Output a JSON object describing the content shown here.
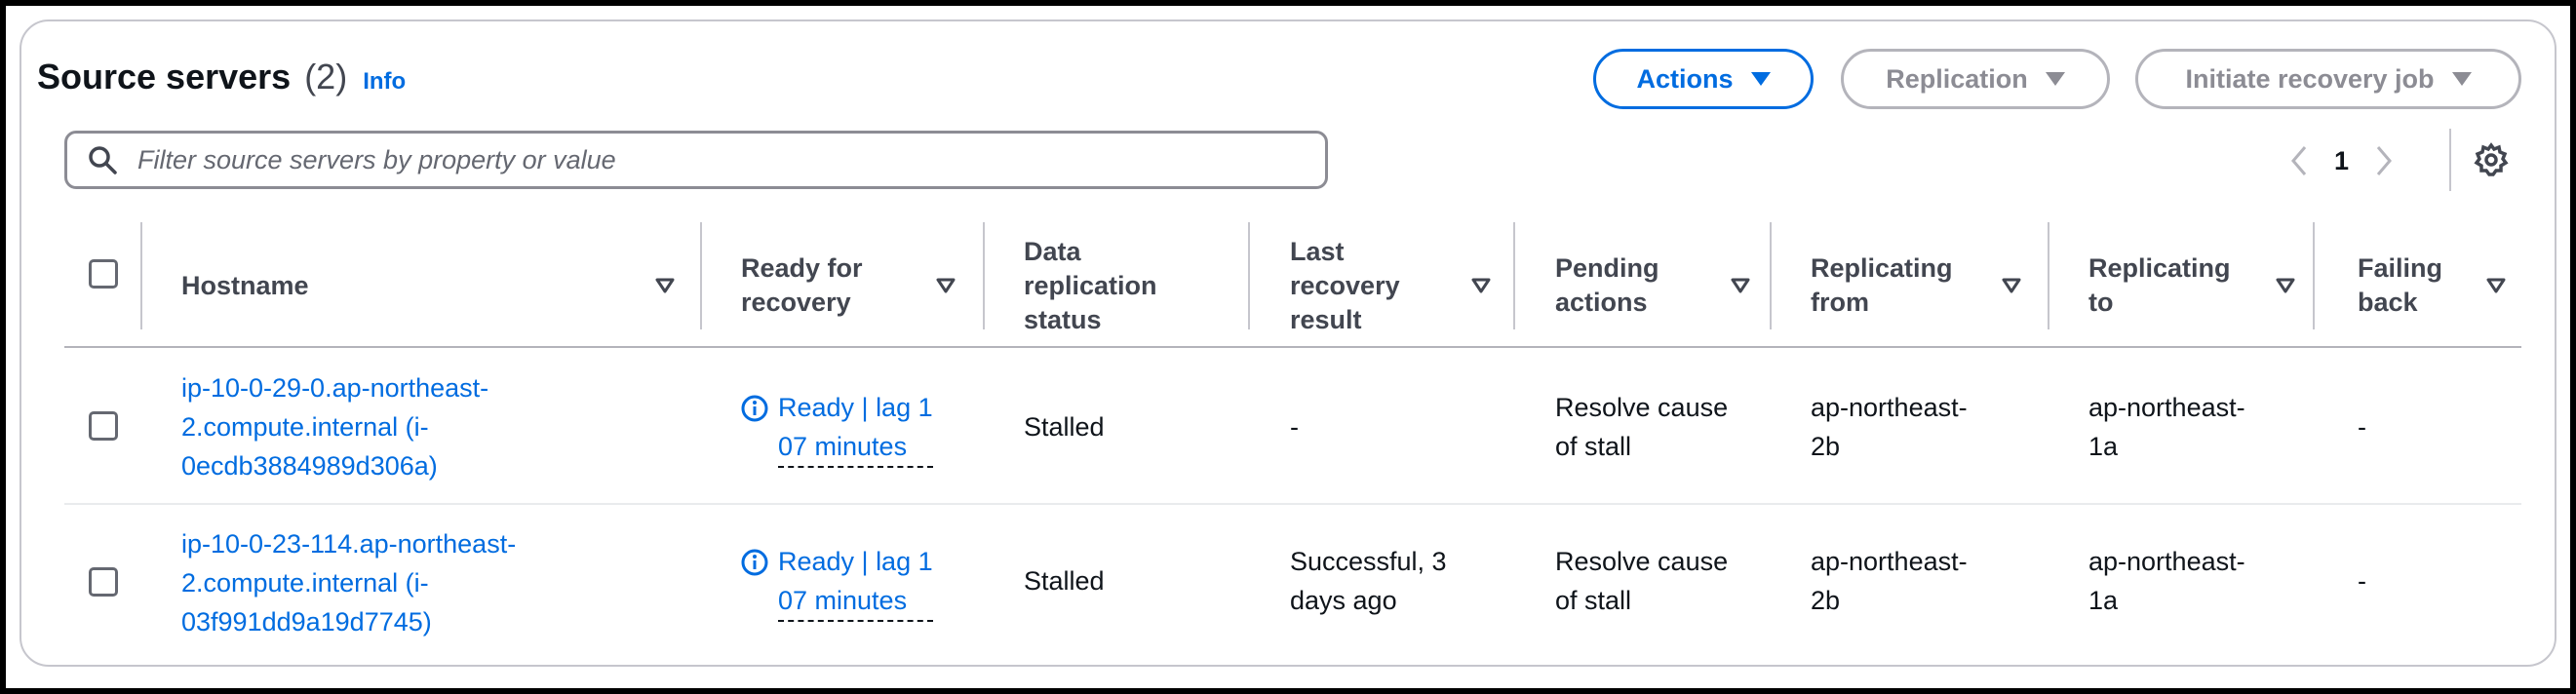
{
  "header": {
    "title": "Source servers",
    "count": "(2)",
    "info_label": "Info"
  },
  "toolbar": {
    "actions_label": "Actions",
    "replication_label": "Replication",
    "initiate_label": "Initiate recovery job"
  },
  "search": {
    "placeholder": "Filter source servers by property or value",
    "value": ""
  },
  "pagination": {
    "current_page": "1"
  },
  "colors": {
    "accent": "#006ce0",
    "disabled": "#8c8c94",
    "text": "#0f141a"
  },
  "columns": [
    "Hostname",
    "Ready for\nrecovery",
    "Data\nreplication\nstatus",
    "Last\nrecovery\nresult",
    "Pending\nactions",
    "Replicating\nfrom",
    "Replicating\nto",
    "Failing\nback"
  ],
  "rows": [
    {
      "hostname": "ip-10-0-29-0.ap-northeast-\n2.compute.internal (i-\n0ecdb3884989d306a)",
      "ready": "Ready | lag 1\n07 minutes",
      "replication_status": "Stalled",
      "last_recovery": "-",
      "pending_actions": "Resolve cause\nof stall",
      "replicating_from": "ap-northeast-\n2b",
      "replicating_to": "ap-northeast-\n1a",
      "failing_back": "-"
    },
    {
      "hostname": "ip-10-0-23-114.ap-northeast-\n2.compute.internal (i-\n03f991dd9a19d7745)",
      "ready": "Ready | lag 1\n07 minutes",
      "replication_status": "Stalled",
      "last_recovery": "Successful, 3\ndays ago",
      "pending_actions": "Resolve cause\nof stall",
      "replicating_from": "ap-northeast-\n2b",
      "replicating_to": "ap-northeast-\n1a",
      "failing_back": "-"
    }
  ]
}
